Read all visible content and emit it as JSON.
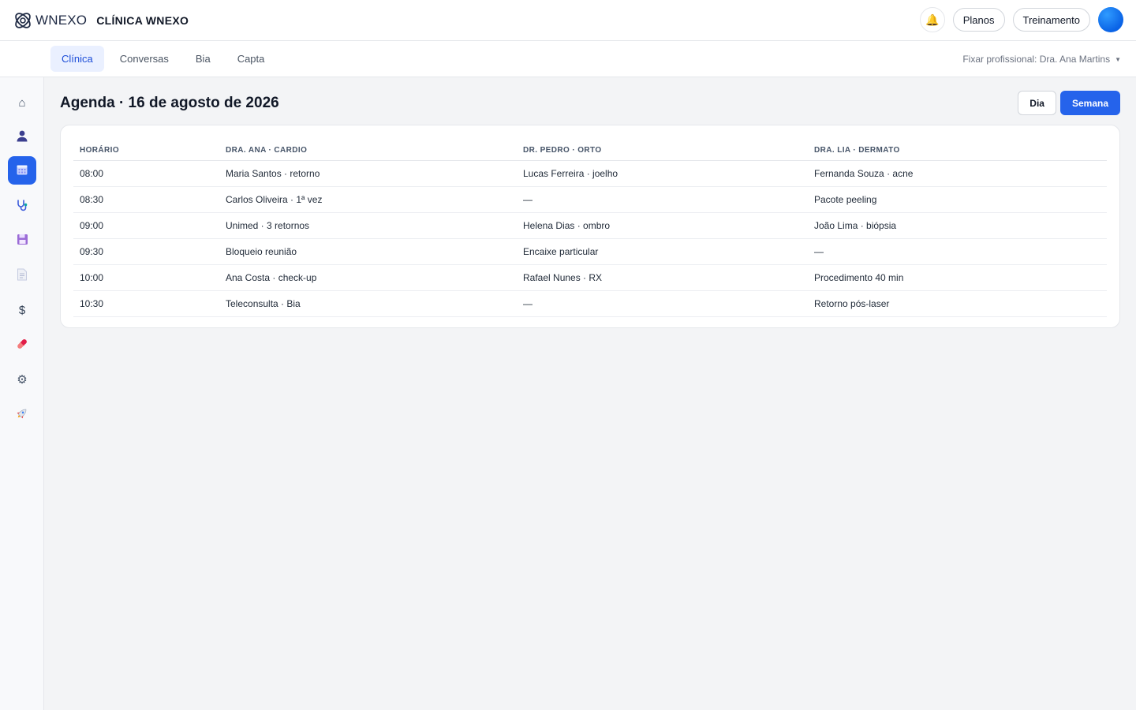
{
  "header": {
    "brand_word": "WNEXO",
    "clinic_name": "CLÍNICA WNEXO",
    "bell_icon": "bell-icon",
    "plans_label": "Planos",
    "training_label": "Treinamento"
  },
  "tabs": [
    {
      "label": "Clínica",
      "active": true
    },
    {
      "label": "Conversas",
      "active": false
    },
    {
      "label": "Bia",
      "active": false
    },
    {
      "label": "Capta",
      "active": false
    }
  ],
  "fix_professional": {
    "label": "Fixar profissional: Dra. Ana Martins"
  },
  "sidebar": {
    "items": [
      {
        "icon": "home-icon",
        "active": false
      },
      {
        "icon": "user-icon",
        "active": false
      },
      {
        "icon": "calendar-icon",
        "active": true
      },
      {
        "icon": "stethoscope-icon",
        "active": false
      },
      {
        "icon": "save-icon",
        "active": false
      },
      {
        "icon": "document-icon",
        "active": false
      },
      {
        "icon": "dollar-icon",
        "active": false
      },
      {
        "icon": "pill-icon",
        "active": false
      },
      {
        "icon": "gear-icon",
        "active": false
      },
      {
        "icon": "rocket-icon",
        "active": false
      }
    ]
  },
  "agenda": {
    "title": "Agenda · 16 de agosto de 2026",
    "view_day": "Dia",
    "view_week": "Semana",
    "columns": [
      "HORÁRIO",
      "DRA. ANA · CARDIO",
      "DR. PEDRO · ORTO",
      "DRA. LIA · DERMATO"
    ],
    "rows": [
      [
        "08:00",
        "Maria Santos · retorno",
        "Lucas Ferreira · joelho",
        "Fernanda Souza · acne"
      ],
      [
        "08:30",
        "Carlos Oliveira · 1ª vez",
        "—",
        "Pacote peeling"
      ],
      [
        "09:00",
        "Unimed · 3 retornos",
        "Helena Dias · ombro",
        "João Lima · biópsia"
      ],
      [
        "09:30",
        "Bloqueio reunião",
        "Encaixe particular",
        "—"
      ],
      [
        "10:00",
        "Ana Costa · check-up",
        "Rafael Nunes · RX",
        "Procedimento 40 min"
      ],
      [
        "10:30",
        "Teleconsulta · Bia",
        "—",
        "Retorno pós-laser"
      ]
    ]
  },
  "colors": {
    "accent": "#2563eb",
    "avatar": "#0a63e6"
  }
}
